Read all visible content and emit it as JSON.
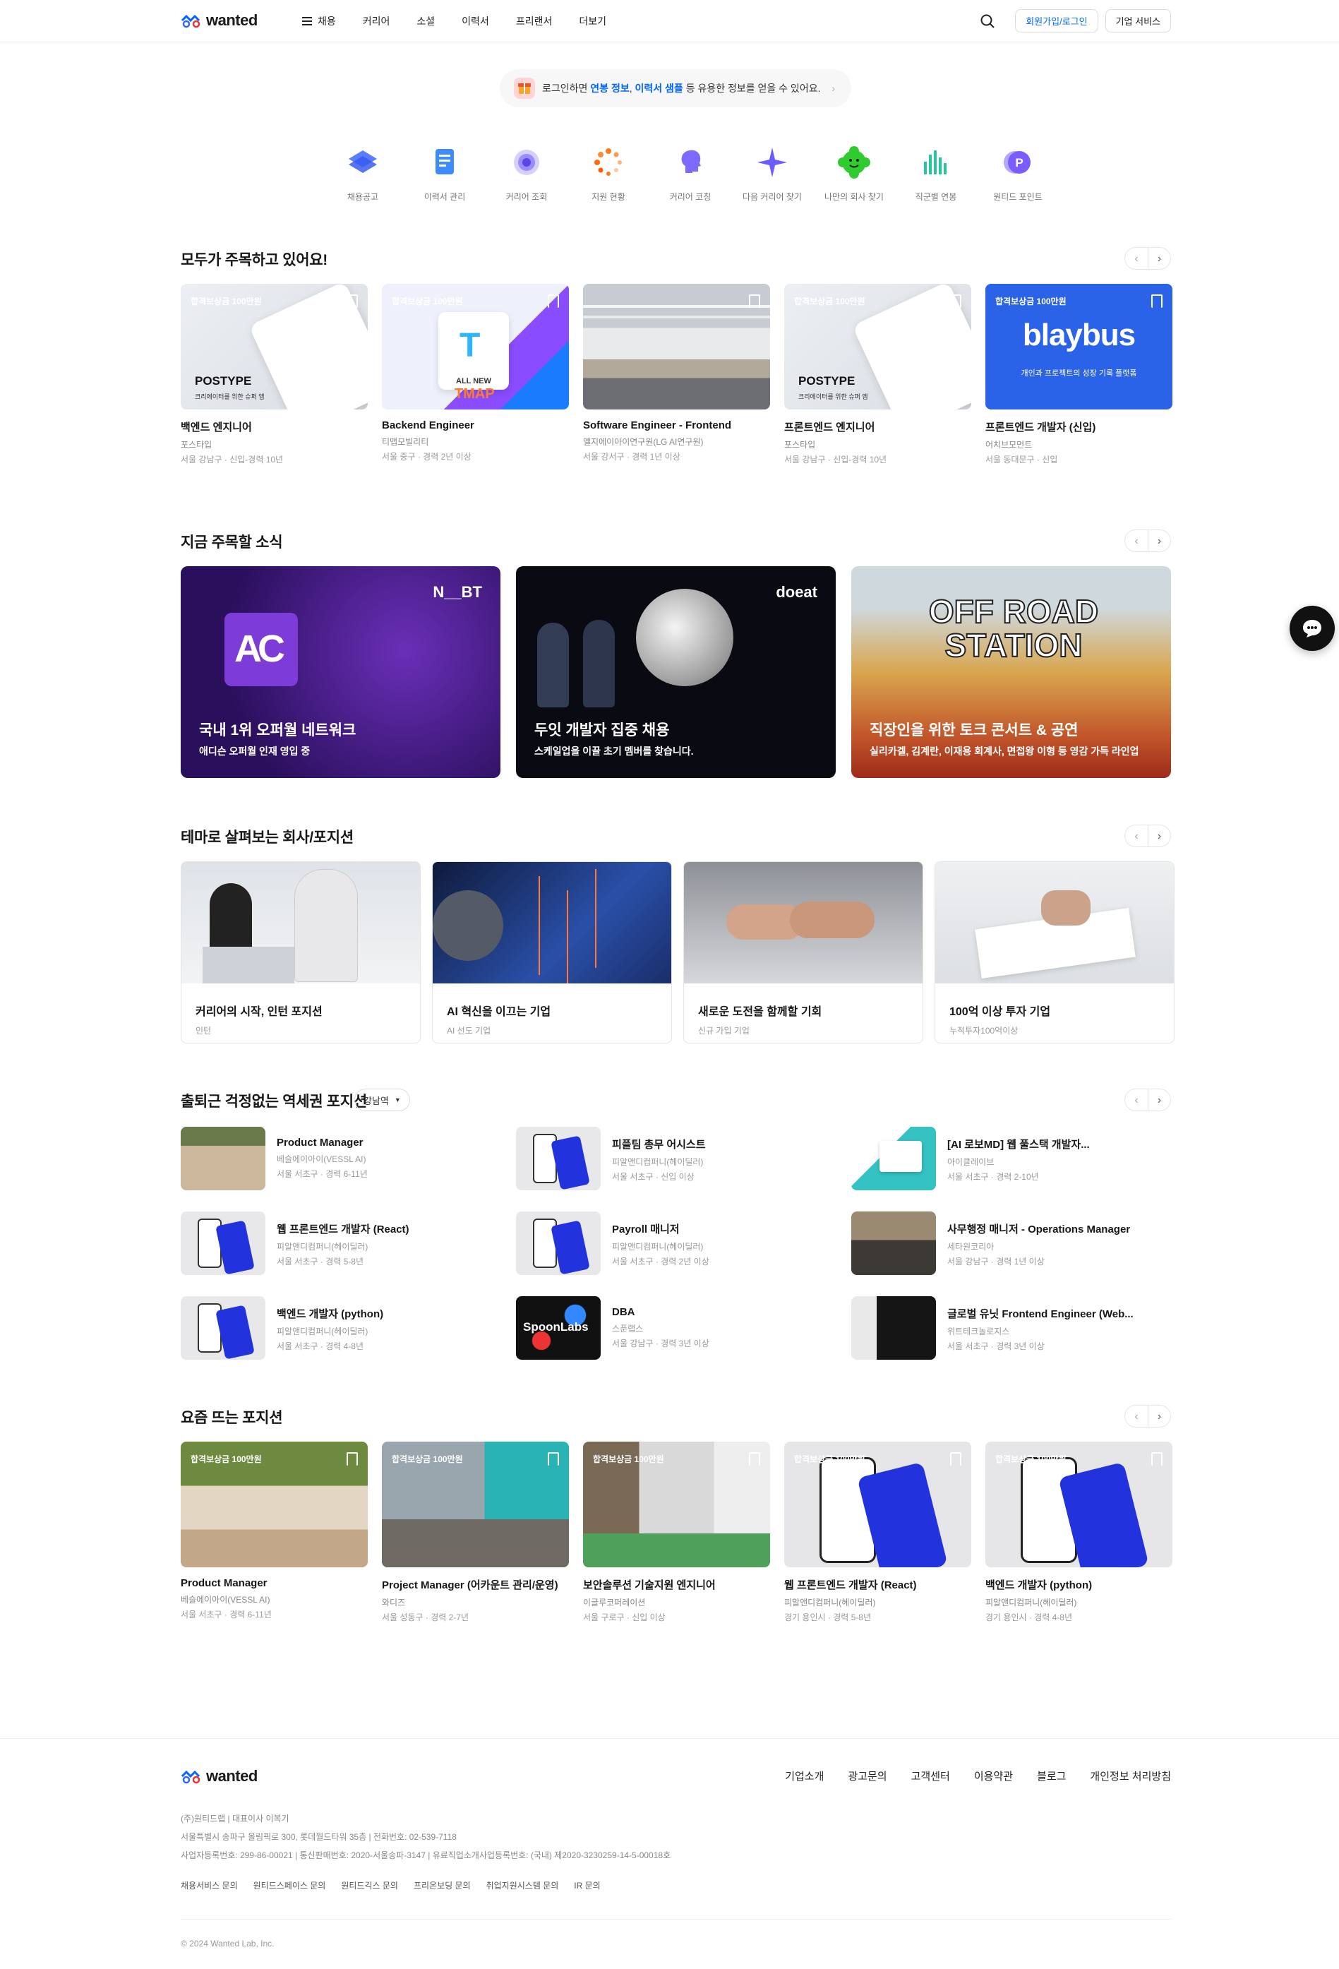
{
  "header": {
    "logo_text": "wanted",
    "menu_label": "채용",
    "nav": [
      "커리어",
      "소셜",
      "이력서",
      "프리랜서",
      "더보기"
    ],
    "signup_label": "회원가입/로그인",
    "biz_label": "기업 서비스"
  },
  "login_banner": {
    "prefix": "로그인하면",
    "hl1": "연봉 정보",
    "sep": ",",
    "hl2": "이력서 샘플",
    "suffix": "등 유용한 정보를 얻을 수 있어요."
  },
  "quick": [
    "채용공고",
    "이력서 관리",
    "커리어 조회",
    "지원 현황",
    "커리어 코칭",
    "다음 커리어 찾기",
    "나만의 회사 찾기",
    "직군별 연봉",
    "원티드 포인트"
  ],
  "featured": {
    "title": "모두가 주목하고 있어요!",
    "cards": [
      {
        "badge": "합격보상금 100만원",
        "overlay": "POSTYPE",
        "overlay_sub": "크리에이터를 위한 슈퍼 앱",
        "title": "백엔드 엔지니어",
        "company": "포스타입",
        "meta": "서울 강남구 · 신입-경력 10년"
      },
      {
        "badge": "합격보상금 100만원",
        "overlay": "ALL NEW",
        "overlay_sub": "TMAP",
        "title": "Backend Engineer",
        "company": "티맵모빌리티",
        "meta": "서울 중구 · 경력 2년 이상"
      },
      {
        "badge": "",
        "overlay": "",
        "overlay_sub": "",
        "title": "Software Engineer - Frontend",
        "company": "엘지에이아이연구원(LG AI연구원)",
        "meta": "서울 강서구 · 경력 1년 이상"
      },
      {
        "badge": "합격보상금 100만원",
        "overlay": "POSTYPE",
        "overlay_sub": "크리에이터를 위한 슈퍼 앱",
        "title": "프론트엔드 엔지니어",
        "company": "포스타입",
        "meta": "서울 강남구 · 신입-경력 10년"
      },
      {
        "badge": "합격보상금 100만원",
        "overlay": "blaybus",
        "overlay_sub": "개인과 프로젝트의 성장 기록 플랫폼",
        "title": "프론트엔드 개발자 (신입)",
        "company": "어치브모먼트",
        "meta": "서울 동대문구 · 신입"
      }
    ]
  },
  "news": {
    "title": "지금 주목할 소식",
    "cards": [
      {
        "logo": "N__BT",
        "title": "국내 1위 오퍼월 네트워크",
        "sub": "애디슨 오퍼월 인재 영입 중"
      },
      {
        "logo": "doeat",
        "title": "두잇 개발자 집중 채용",
        "sub": "스케일업을 이끌 초기 멤버를 찾습니다."
      },
      {
        "logo": "OFF ROAD STATION",
        "title": "직장인을 위한 토크 콘서트 & 공연",
        "sub": "실리카겔, 김계란, 이재용 회계사, 면접왕 이형 등 영감 가득 라인업"
      }
    ]
  },
  "themes": {
    "title": "테마로 살펴보는 회사/포지션",
    "cards": [
      {
        "title": "커리어의 시작, 인턴 포지션",
        "sub": "인턴"
      },
      {
        "title": "AI 혁신을 이끄는 기업",
        "sub": "AI 선도 기업"
      },
      {
        "title": "새로운 도전을 함께할 기회",
        "sub": "신규 가입 기업"
      },
      {
        "title": "100억 이상 투자 기업",
        "sub": "누적투자100억이상"
      }
    ]
  },
  "station": {
    "title": "출퇴근 걱정없는 역세권 포지션",
    "dropdown": "강남역",
    "items": [
      {
        "title": "Product Manager",
        "company": "베슬에이아이(VESSL AI)",
        "meta": "서울 서초구 · 경력 6-11년"
      },
      {
        "title": "피플팀 총무 어시스트",
        "company": "피알앤디컴퍼니(헤이딜러)",
        "meta": "서울 서초구 · 신입 이상"
      },
      {
        "title": "[AI 로보MD] 웹 풀스택 개발자...",
        "company": "아이클레이브",
        "meta": "서울 서초구 · 경력 2-10년"
      },
      {
        "title": "웹 프론트엔드 개발자 (React)",
        "company": "피알앤디컴퍼니(헤이딜러)",
        "meta": "서울 서초구 · 경력 5-8년"
      },
      {
        "title": "Payroll 매니저",
        "company": "피알앤디컴퍼니(헤이딜러)",
        "meta": "서울 서초구 · 경력 2년 이상"
      },
      {
        "title": "사무행정 매니저 - Operations Manager",
        "company": "세타원코리아",
        "meta": "서울 강남구 · 경력 1년 이상"
      },
      {
        "title": "백엔드 개발자 (python)",
        "company": "피알앤디컴퍼니(헤이딜러)",
        "meta": "서울 서초구 · 경력 4-8년"
      },
      {
        "title": "DBA",
        "company": "스푼랩스",
        "meta": "서울 강남구 · 경력 3년 이상"
      },
      {
        "title": "글로벌 유닛 Frontend Engineer (Web...",
        "company": "위트테크놀로지스",
        "meta": "서울 서초구 · 경력 3년 이상"
      }
    ]
  },
  "hot": {
    "title": "요즘 뜨는 포지션",
    "cards": [
      {
        "badge": "합격보상금 100만원",
        "title": "Product Manager",
        "company": "베슬에이아이(VESSL AI)",
        "meta": "서울 서초구 · 경력 6-11년"
      },
      {
        "badge": "합격보상금 100만원",
        "title": "Project Manager (어카운트 관리/운영)",
        "company": "와디즈",
        "meta": "서울 성동구 · 경력 2-7년"
      },
      {
        "badge": "합격보상금 100만원",
        "title": "보안솔루션 기술지원 엔지니어",
        "company": "이글루코퍼레이션",
        "meta": "서울 구로구 · 신입 이상"
      },
      {
        "badge": "합격보상금 100만원",
        "title": "웹 프론트엔드 개발자 (React)",
        "company": "피알앤디컴퍼니(헤이딜러)",
        "meta": "경기 용인시 · 경력 5-8년"
      },
      {
        "badge": "합격보상금 100만원",
        "title": "백엔드 개발자 (python)",
        "company": "피알앤디컴퍼니(헤이딜러)",
        "meta": "경기 용인시 · 경력 4-8년"
      }
    ]
  },
  "footer": {
    "links": [
      "기업소개",
      "광고문의",
      "고객센터",
      "이용약관",
      "블로그",
      "개인정보 처리방침"
    ],
    "line1": "(주)원티드랩   |   대표이사 이복기",
    "line2": "서울특별시 송파구 올림픽로 300, 롯데월드타워 35층   |   전화번호: 02-539-7118",
    "line3": "사업자등록번호: 299-86-00021   |   통신판매번호: 2020-서울송파-3147   |   유료직업소개사업등록번호: (국내) 제2020-3230259-14-5-00018호",
    "sub_links": [
      "채용서비스 문의",
      "원티드스페이스 문의",
      "원티드긱스 문의",
      "프리온보딩 문의",
      "취업지원시스템 문의",
      "IR 문의"
    ],
    "copyright": "© 2024 Wanted Lab, Inc."
  },
  "colors": {
    "accent": "#0066ff"
  }
}
